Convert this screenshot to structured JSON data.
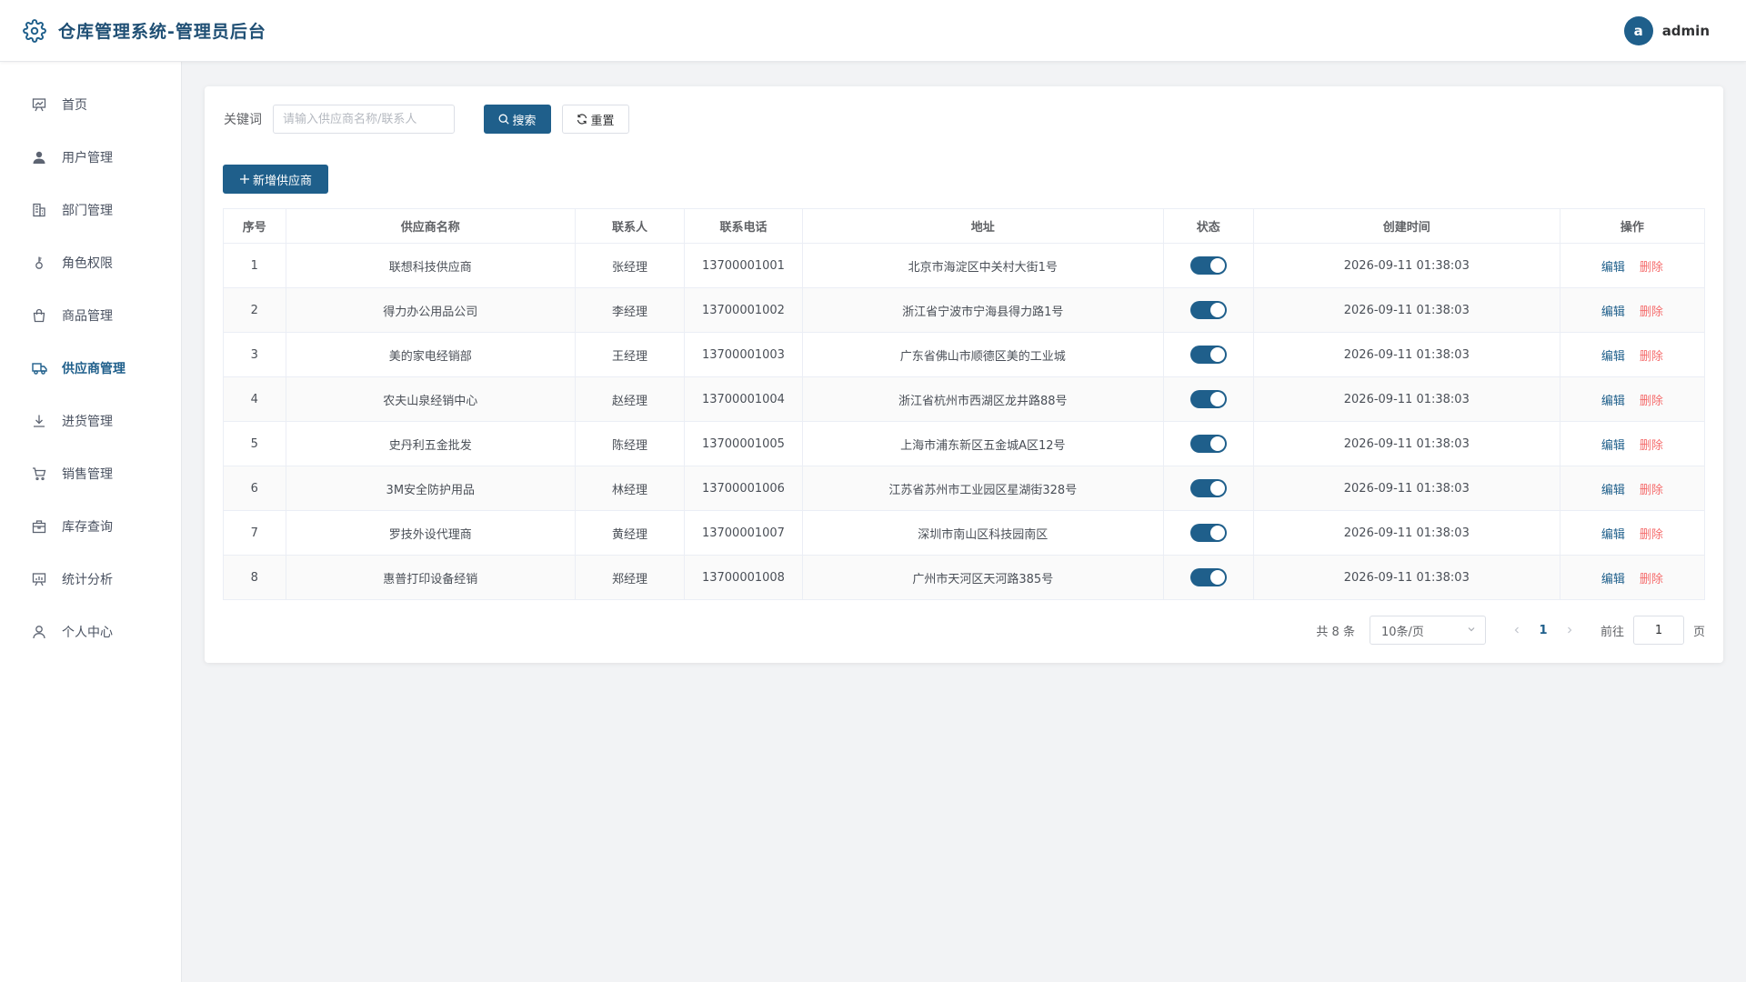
{
  "app": {
    "title": "仓库管理系统-管理员后台",
    "logo_icon": "gear-icon"
  },
  "user": {
    "avatar_letter": "a",
    "name": "admin"
  },
  "sidebar": {
    "items": [
      {
        "label": "首页",
        "icon": "presentation-chart-icon",
        "active": false
      },
      {
        "label": "用户管理",
        "icon": "user-icon",
        "active": false
      },
      {
        "label": "部门管理",
        "icon": "building-icon",
        "active": false
      },
      {
        "label": "角色权限",
        "icon": "key-icon",
        "active": false
      },
      {
        "label": "商品管理",
        "icon": "shopping-bag-icon",
        "active": false
      },
      {
        "label": "供应商管理",
        "icon": "truck-icon",
        "active": true
      },
      {
        "label": "进货管理",
        "icon": "download-icon",
        "active": false
      },
      {
        "label": "销售管理",
        "icon": "cart-icon",
        "active": false
      },
      {
        "label": "库存查询",
        "icon": "box-icon",
        "active": false
      },
      {
        "label": "统计分析",
        "icon": "chart-board-icon",
        "active": false
      },
      {
        "label": "个人中心",
        "icon": "person-outline-icon",
        "active": false
      }
    ]
  },
  "filter": {
    "keyword_label": "关键词",
    "keyword_placeholder": "请输入供应商名称/联系人",
    "keyword_value": "",
    "search_label": "搜索",
    "reset_label": "重置"
  },
  "toolbar": {
    "add_label": "新增供应商"
  },
  "table": {
    "columns": [
      "序号",
      "供应商名称",
      "联系人",
      "联系电话",
      "地址",
      "状态",
      "创建时间",
      "操作"
    ],
    "edit_label": "编辑",
    "delete_label": "删除",
    "rows": [
      {
        "index": "1",
        "name": "联想科技供应商",
        "contact": "张经理",
        "phone": "13700001001",
        "address": "北京市海淀区中关村大街1号",
        "enabled": true,
        "created": "2026-09-11 01:38:03"
      },
      {
        "index": "2",
        "name": "得力办公用品公司",
        "contact": "李经理",
        "phone": "13700001002",
        "address": "浙江省宁波市宁海县得力路1号",
        "enabled": true,
        "created": "2026-09-11 01:38:03"
      },
      {
        "index": "3",
        "name": "美的家电经销部",
        "contact": "王经理",
        "phone": "13700001003",
        "address": "广东省佛山市顺德区美的工业城",
        "enabled": true,
        "created": "2026-09-11 01:38:03"
      },
      {
        "index": "4",
        "name": "农夫山泉经销中心",
        "contact": "赵经理",
        "phone": "13700001004",
        "address": "浙江省杭州市西湖区龙井路88号",
        "enabled": true,
        "created": "2026-09-11 01:38:03"
      },
      {
        "index": "5",
        "name": "史丹利五金批发",
        "contact": "陈经理",
        "phone": "13700001005",
        "address": "上海市浦东新区五金城A区12号",
        "enabled": true,
        "created": "2026-09-11 01:38:03"
      },
      {
        "index": "6",
        "name": "3M安全防护用品",
        "contact": "林经理",
        "phone": "13700001006",
        "address": "江苏省苏州市工业园区星湖街328号",
        "enabled": true,
        "created": "2026-09-11 01:38:03"
      },
      {
        "index": "7",
        "name": "罗技外设代理商",
        "contact": "黄经理",
        "phone": "13700001007",
        "address": "深圳市南山区科技园南区",
        "enabled": true,
        "created": "2026-09-11 01:38:03"
      },
      {
        "index": "8",
        "name": "惠普打印设备经销",
        "contact": "郑经理",
        "phone": "13700001008",
        "address": "广州市天河区天河路385号",
        "enabled": true,
        "created": "2026-09-11 01:38:03"
      }
    ]
  },
  "pagination": {
    "total_text": "共 8 条",
    "page_size": "10条/页",
    "current_page": "1",
    "goto_label": "前往",
    "goto_value": "1",
    "page_suffix": "页"
  },
  "colors": {
    "primary": "#1f5f8b",
    "danger": "#f56c6c",
    "background": "#f2f3f5"
  }
}
